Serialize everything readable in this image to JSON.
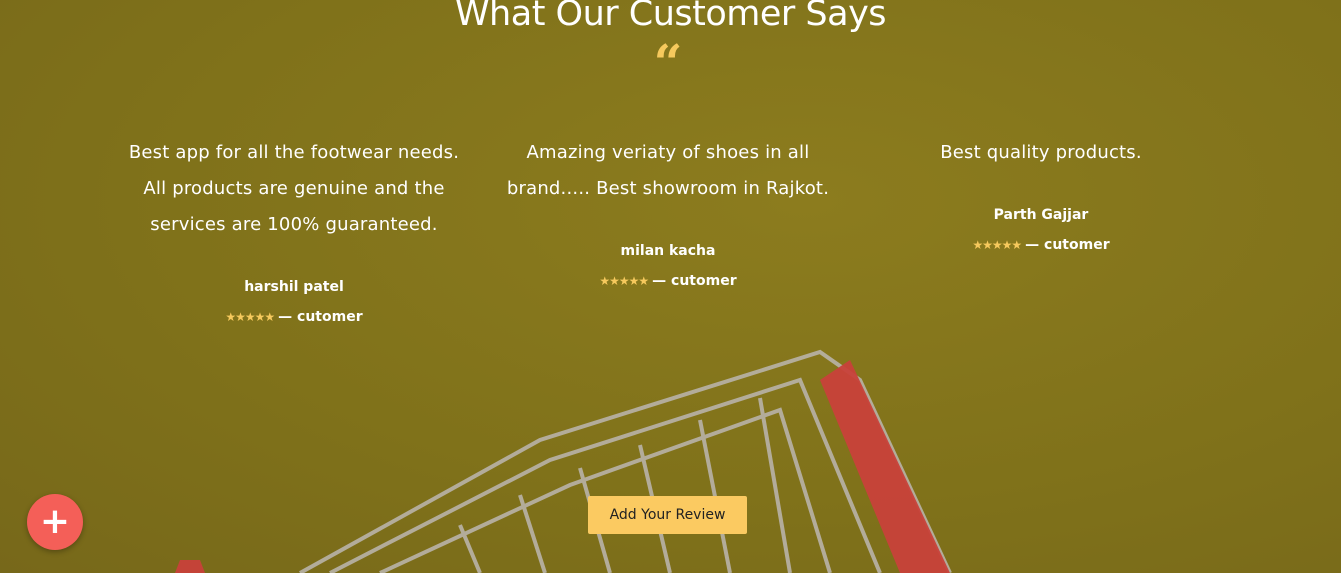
{
  "heading": "What Our Customer Says",
  "quote_mark": "“",
  "reviews": [
    {
      "text": "Best app for all the footwear needs. All products are genuine and the services are 100% guaranteed.",
      "name": "harshil patel",
      "stars": "★★★★★",
      "role": "— cutomer"
    },
    {
      "text": "Amazing veriaty of shoes in all brand..... Best showroom in Rajkot.",
      "name": "milan kacha",
      "stars": "★★★★★",
      "role": "— cutomer"
    },
    {
      "text": "Best quality products.",
      "name": "Parth Gajjar",
      "stars": "★★★★★",
      "role": "— cutomer"
    }
  ],
  "add_review_label": "Add Your Review",
  "fab_icon": "plus-icon",
  "colors": {
    "background": "#86761c",
    "accent": "#f6c95d",
    "button": "#fbca61",
    "fab": "#f45f58"
  }
}
